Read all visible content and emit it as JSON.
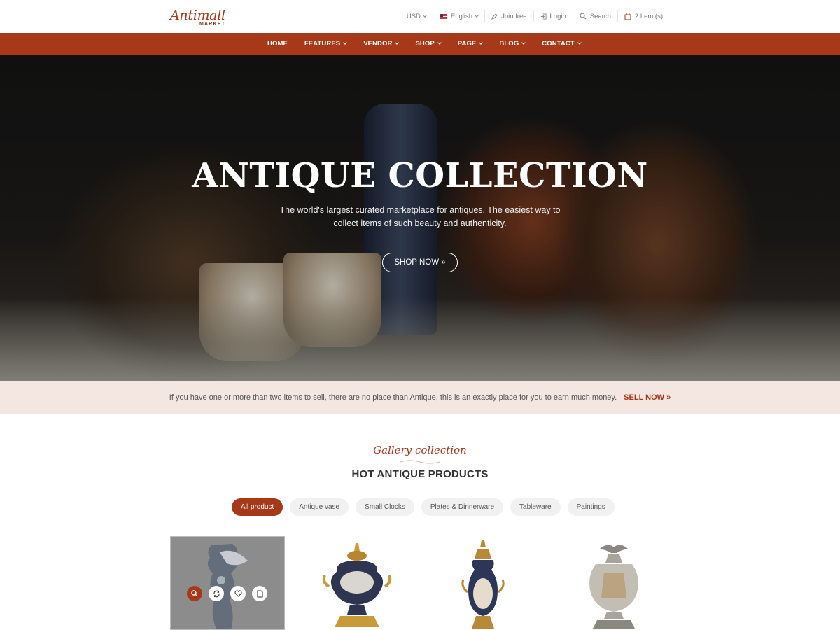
{
  "brand": {
    "logo_main": "Antimall",
    "logo_sub": "MARKET"
  },
  "topbar": {
    "currency": "USD",
    "language": "English",
    "join": "Join free",
    "login": "Login",
    "search": "Search",
    "cart": "2 Item (s)"
  },
  "nav": {
    "items": [
      {
        "label": "HOME",
        "has_dropdown": false
      },
      {
        "label": "FEATURES",
        "has_dropdown": true
      },
      {
        "label": "VENDOR",
        "has_dropdown": true
      },
      {
        "label": "SHOP",
        "has_dropdown": true
      },
      {
        "label": "PAGE",
        "has_dropdown": true
      },
      {
        "label": "BLOG",
        "has_dropdown": true
      },
      {
        "label": "CONTACT",
        "has_dropdown": true
      }
    ]
  },
  "hero": {
    "title": "ANTIQUE COLLECTION",
    "subtitle": "The world's largest curated marketplace for antiques. The easiest way to collect items of such beauty and authenticity.",
    "button": "SHOP NOW »"
  },
  "sell_banner": {
    "text": "If you have one or more than two items to sell, there are no place than Antique, this is an exactly place for you to earn much money.",
    "link": "SELL NOW »"
  },
  "section": {
    "script_title": "Gallery collection",
    "title": "HOT ANTIQUE PRODUCTS"
  },
  "filters": [
    {
      "label": "All product",
      "active": true
    },
    {
      "label": "Antique vase",
      "active": false
    },
    {
      "label": "Small Clocks",
      "active": false
    },
    {
      "label": "Plates & Dinnerware",
      "active": false
    },
    {
      "label": "Tableware",
      "active": false
    },
    {
      "label": "Paintings",
      "active": false
    }
  ],
  "products": [
    {
      "image": "ornate-ewer",
      "hovered": true,
      "actions": [
        "search-icon",
        "compare-icon",
        "heart-icon",
        "document-icon"
      ]
    },
    {
      "image": "gilded-urn",
      "hovered": false
    },
    {
      "image": "sevres-vase",
      "hovered": false
    },
    {
      "image": "silver-eagle-urn",
      "hovered": false
    }
  ],
  "colors": {
    "brand": "#a5391a",
    "sell_bg": "#f4e6e1",
    "chip_bg": "#f1f1f1"
  }
}
